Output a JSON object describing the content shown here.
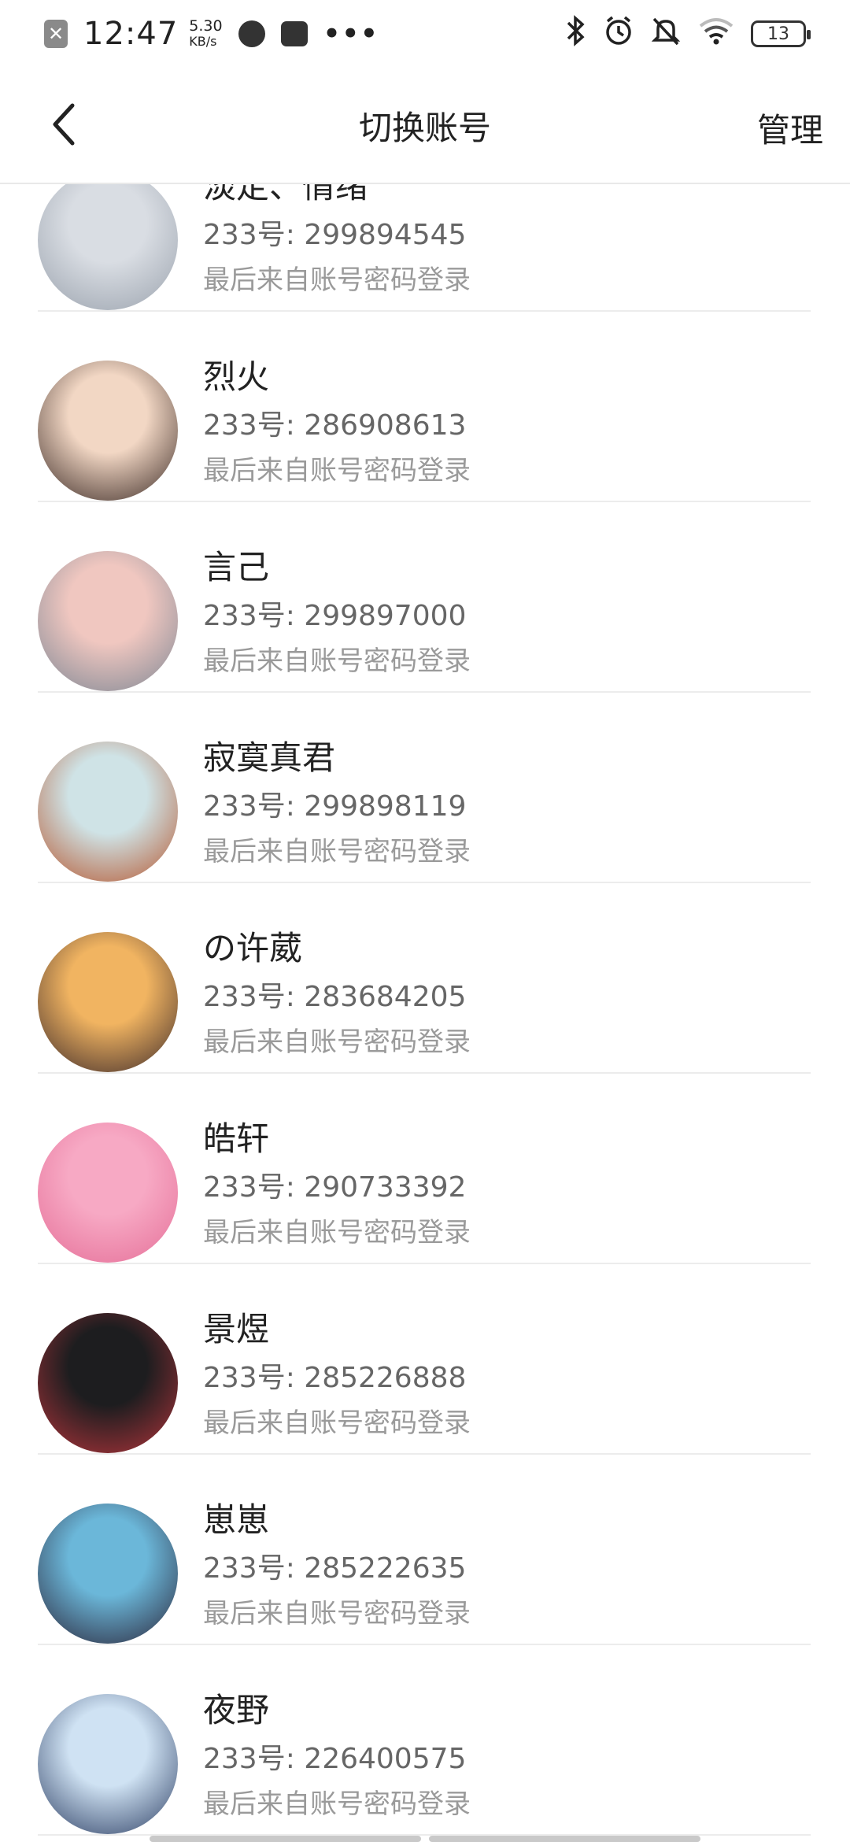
{
  "status_bar": {
    "time": "12:47",
    "net_speed": "5.30",
    "net_unit": "KB/s",
    "more": "•••",
    "battery": "13"
  },
  "header": {
    "title": "切换账号",
    "manage": "管理"
  },
  "accounts": [
    {
      "name": "淡定、情绪",
      "uid": "233号: 299894545",
      "login": "最后来自账号密码登录"
    },
    {
      "name": "烈火",
      "uid": "233号: 286908613",
      "login": "最后来自账号密码登录"
    },
    {
      "name": "言己",
      "uid": "233号: 299897000",
      "login": "最后来自账号密码登录"
    },
    {
      "name": "寂寞真君",
      "uid": "233号: 299898119",
      "login": "最后来自账号密码登录"
    },
    {
      "name": "の许葳",
      "uid": "233号: 283684205",
      "login": "最后来自账号密码登录"
    },
    {
      "name": "皓轩",
      "uid": "233号: 290733392",
      "login": "最后来自账号密码登录"
    },
    {
      "name": "景煜",
      "uid": "233号: 285226888",
      "login": "最后来自账号密码登录"
    },
    {
      "name": "崽崽",
      "uid": "233号: 285222635",
      "login": "最后来自账号密码登录"
    },
    {
      "name": "夜野",
      "uid": "233号: 226400575",
      "login": "最后来自账号密码登录"
    }
  ],
  "avatar_colors": [
    [
      "#d9dde3",
      "#9aa2ad"
    ],
    [
      "#f2d7c4",
      "#3b2a25"
    ],
    [
      "#f0c7c0",
      "#7e8794"
    ],
    [
      "#cfe3e6",
      "#b5562f"
    ],
    [
      "#f1b461",
      "#3d2a2a"
    ],
    [
      "#f7a9c4",
      "#e56f98"
    ],
    [
      "#1d1d1f",
      "#b3343b"
    ],
    [
      "#6bb7d9",
      "#2a2438"
    ],
    [
      "#cfe2f3",
      "#2c3e63"
    ]
  ]
}
